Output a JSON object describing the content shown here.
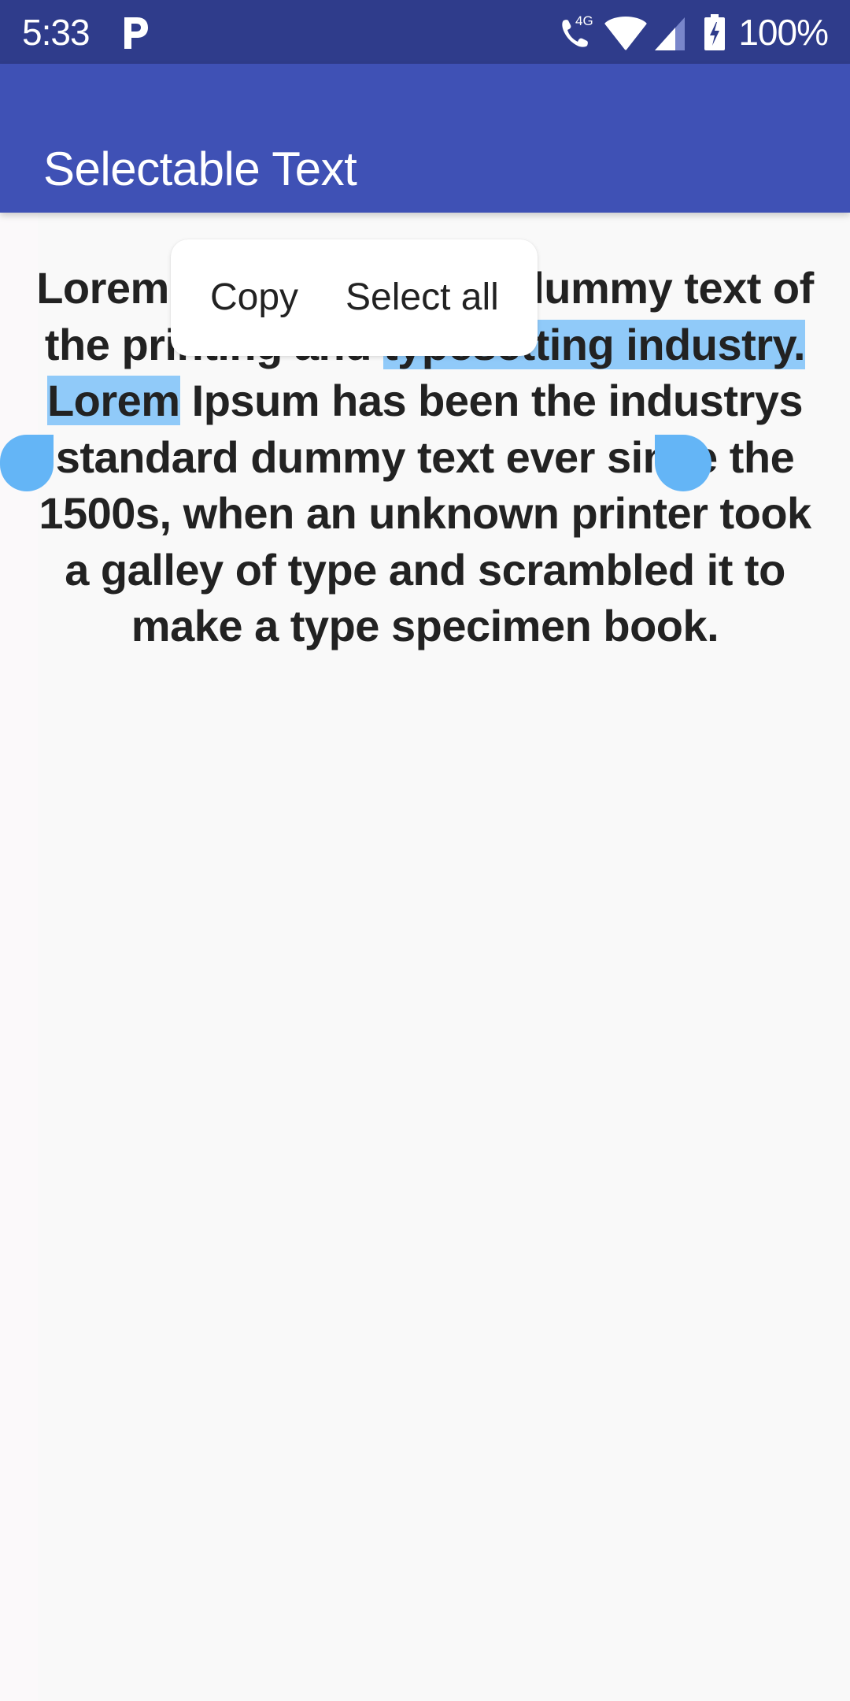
{
  "status_bar": {
    "time": "5:33",
    "notification_icon": "parking-p-icon",
    "icons": [
      "wifi-calling-4g-icon",
      "wifi-icon",
      "cell-signal-icon",
      "battery-charging-icon"
    ],
    "call_label": "4G",
    "battery_percent": "100%"
  },
  "app_bar": {
    "title": "Selectable Text",
    "background_color": "#3f51b5",
    "status_bar_color": "#2f3c8b"
  },
  "content": {
    "paragraph": {
      "before_selection": "Lorem Ipsum is simply dummy text of the printing and ",
      "selected_text": "typesetting industry. Lorem",
      "after_selection": " Ipsum has been the industrys standard dummy text ever since the 1500s, when an unknown printer took a galley of type and scrambled it to make a type specimen book."
    },
    "selection_color": "#90caf9",
    "handle_color": "#64b5f6"
  },
  "text_selection_toolbar": {
    "items": [
      {
        "label": "Copy"
      },
      {
        "label": "Select all"
      }
    ]
  }
}
